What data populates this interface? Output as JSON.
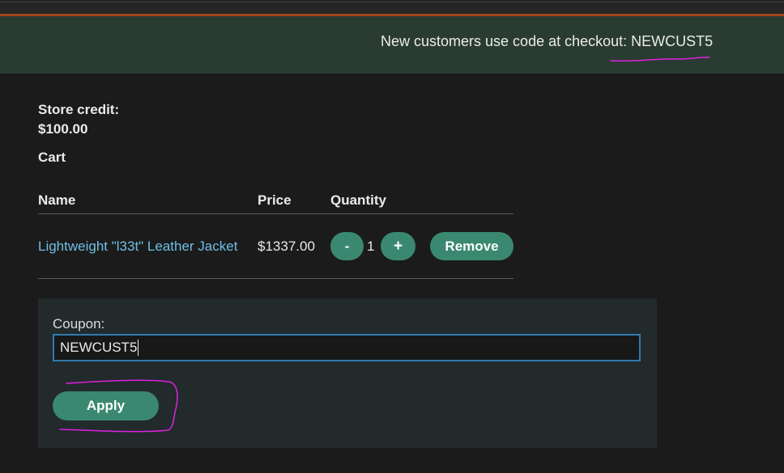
{
  "banner": {
    "text": "New customers use code at checkout: NEWCUST5"
  },
  "store": {
    "credit_label": "Store credit:",
    "credit_value": "$100.00"
  },
  "cart": {
    "title": "Cart",
    "columns": [
      "Name",
      "Price",
      "Quantity"
    ],
    "items": [
      {
        "name": "Lightweight \"l33t\" Leather Jacket",
        "price": "$1337.00",
        "quantity": "1",
        "minus_label": "-",
        "plus_label": "+",
        "remove_label": "Remove"
      }
    ]
  },
  "coupon": {
    "label": "Coupon:",
    "value": "NEWCUST5",
    "apply_label": "Apply"
  },
  "colors": {
    "banner_bg": "#2a3c31",
    "accent_button": "#3a8870",
    "link": "#6ebfe3",
    "annotation": "#e020e0",
    "top_accent_line": "#a0451d"
  }
}
